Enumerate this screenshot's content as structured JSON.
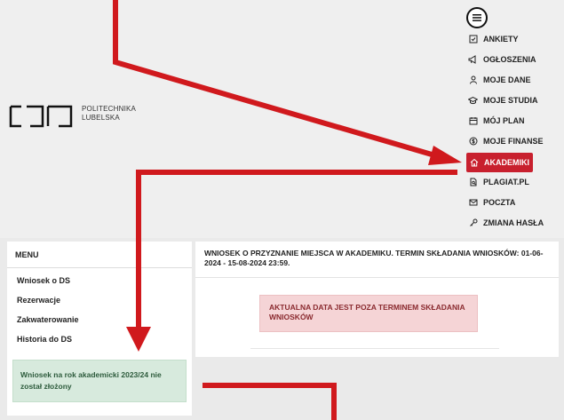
{
  "logo": {
    "line1": "POLITECHNIKA",
    "line2": "LUBELSKA"
  },
  "nav": {
    "items": [
      {
        "label": "ANKIETY",
        "icon": "survey-icon"
      },
      {
        "label": "OGŁOSZENIA",
        "icon": "megaphone-icon"
      },
      {
        "label": "MOJE DANE",
        "icon": "user-icon"
      },
      {
        "label": "MOJE STUDIA",
        "icon": "graduation-cap-icon"
      },
      {
        "label": "MÓJ PLAN",
        "icon": "calendar-icon"
      },
      {
        "label": "MOJE FINANSE",
        "icon": "dollar-icon"
      },
      {
        "label": "AKADEMIKI",
        "icon": "home-icon",
        "active": true
      },
      {
        "label": "PLAGIAT.PL",
        "icon": "document-search-icon"
      },
      {
        "label": "POCZTA",
        "icon": "mail-icon"
      },
      {
        "label": "ZMIANA HASŁA",
        "icon": "key-icon"
      }
    ]
  },
  "sidebar": {
    "title": "MENU",
    "items": [
      {
        "label": "Wniosek o DS"
      },
      {
        "label": "Rezerwacje"
      },
      {
        "label": "Zakwaterowanie"
      },
      {
        "label": "Historia do DS"
      }
    ],
    "notice": "Wniosek na rok akademicki 2023/24 nie został złożony"
  },
  "main": {
    "title": "WNIOSEK O PRZYZNANIE MIEJSCA W AKADEMIKU. TERMIN SKŁADANIA WNIOSKÓW: 01-06-2024 - 15-08-2024 23:59.",
    "alert": "AKTUALNA DATA JEST POZA TERMINEM SKŁADANIA WNIOSKÓW"
  },
  "colors": {
    "accent": "#c8202e",
    "arrow": "#d0191d",
    "success_bg": "#d7eadd",
    "danger_bg": "#f5d4d6"
  }
}
